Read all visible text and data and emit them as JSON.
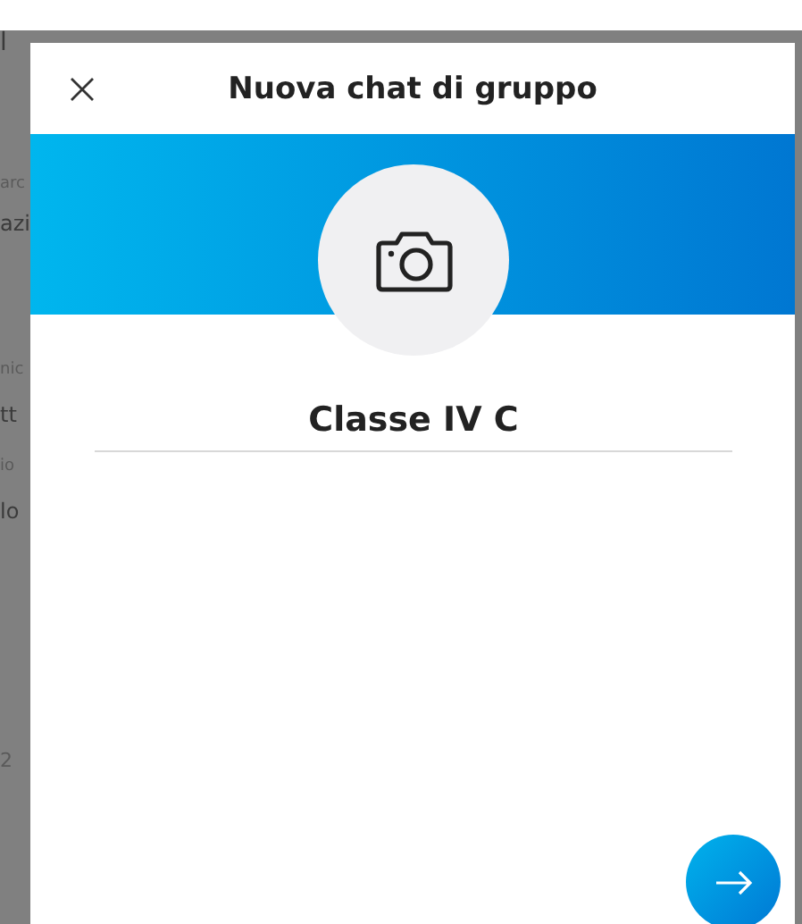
{
  "background_page": {
    "fragments": [
      {
        "text": "l",
        "kind": "heading"
      },
      {
        "text": "arc",
        "kind": "caption"
      },
      {
        "text": "azi",
        "kind": "value"
      },
      {
        "text": "nic",
        "kind": "caption"
      },
      {
        "text": "tt",
        "kind": "value"
      },
      {
        "text": "io",
        "kind": "caption"
      },
      {
        "text": "lo",
        "kind": "value"
      },
      {
        "text": "2",
        "kind": "caption"
      }
    ]
  },
  "dialog": {
    "title": "Nuova chat di gruppo",
    "group_name": {
      "value": "Classe IV C"
    }
  }
}
